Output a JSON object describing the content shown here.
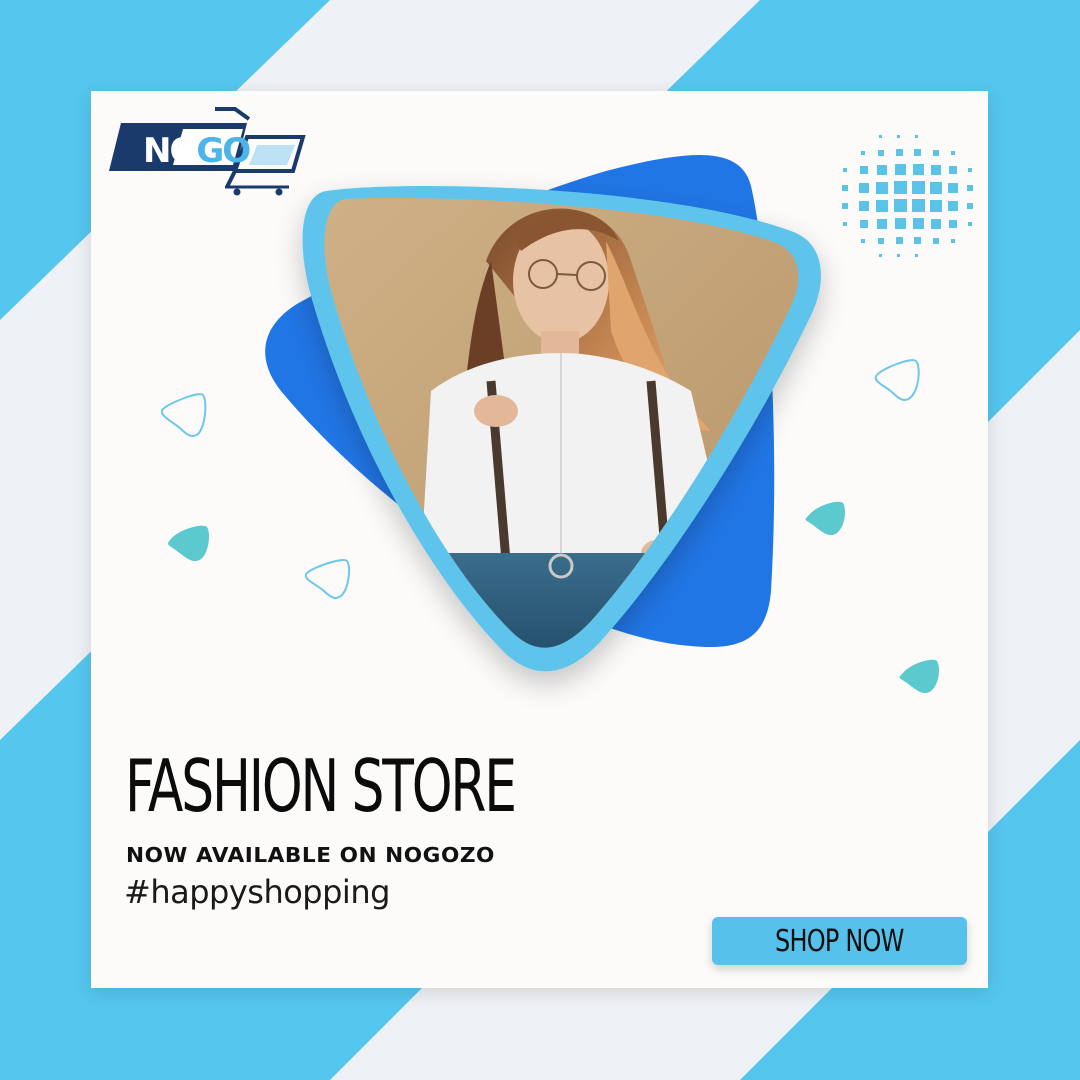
{
  "brand": {
    "logo_part1": "NO",
    "logo_part2": "GO"
  },
  "headline": "FASHION STORE",
  "subline": "NOW AVAILABLE ON NOGOZO",
  "hashtag": "#happyshopping",
  "cta": {
    "label": "SHOP NOW"
  },
  "colors": {
    "background_blue": "#55c6ee",
    "background_light": "#eef0f4",
    "card": "#fcfbfa",
    "frame_light_blue": "#5fc4ec",
    "accent_blue": "#2176e6",
    "teal_triangle": "#5cc9cf",
    "button": "#56c2ec",
    "logo_navy": "#1a3a6b"
  },
  "icons": {
    "logo": "shopping-cart-logo",
    "dot_grid": "dot-grid-decoration",
    "triangles": "rounded-triangle-decoration"
  }
}
